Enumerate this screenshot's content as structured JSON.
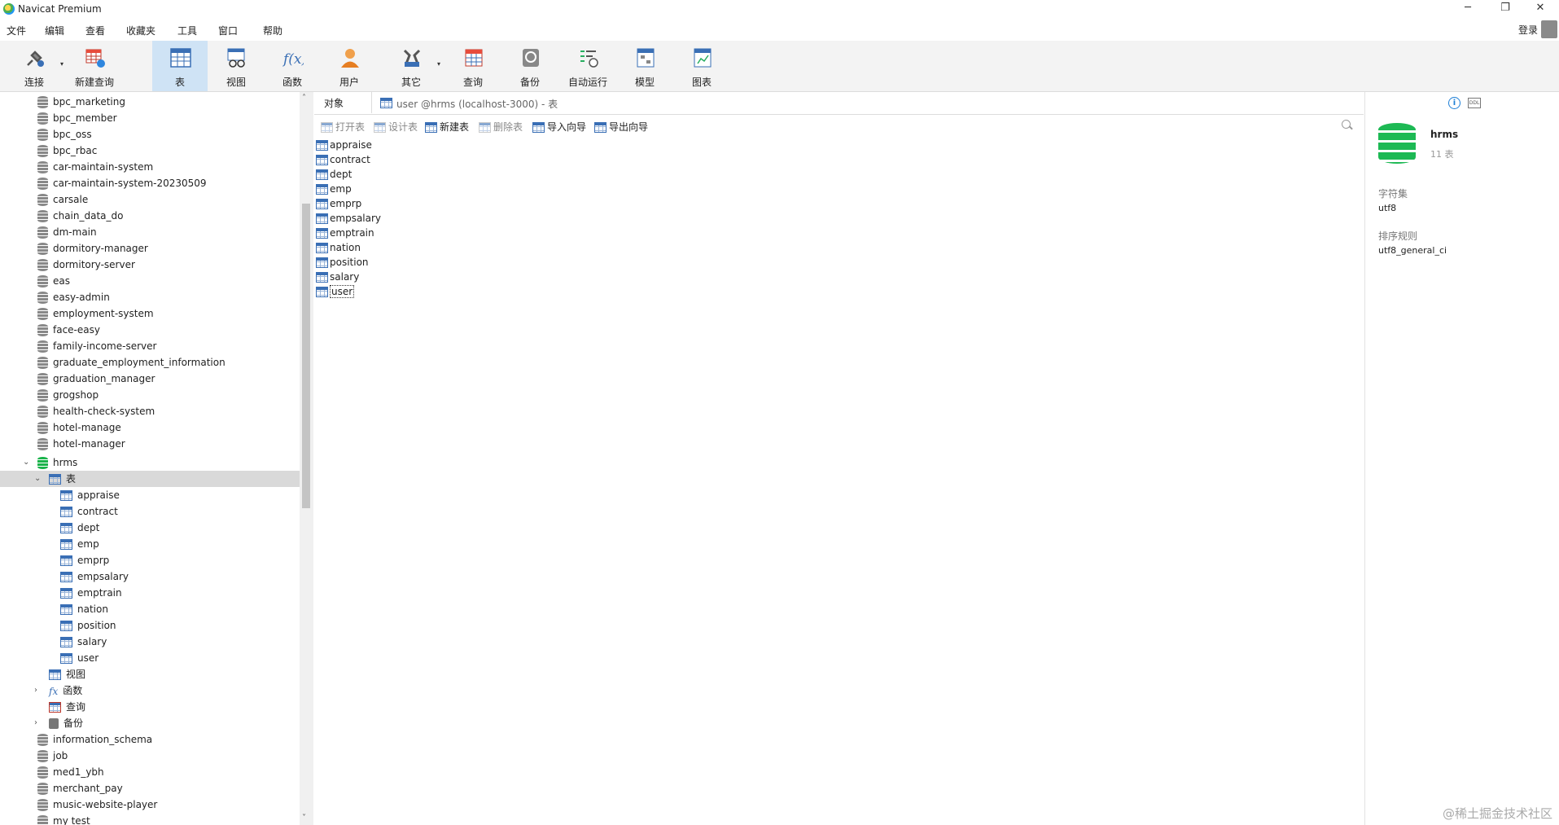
{
  "window": {
    "title": "Navicat Premium",
    "minimize": "─",
    "restore": "❐",
    "close": "✕"
  },
  "menu": [
    "文件",
    "编辑",
    "查看",
    "收藏夹",
    "工具",
    "窗口",
    "帮助"
  ],
  "login": "登录",
  "toolbar": [
    {
      "label": "连接",
      "icon": "plug-icon"
    },
    {
      "label": "新建查询",
      "icon": "new-query-icon"
    },
    {
      "label": "表",
      "icon": "table-icon"
    },
    {
      "label": "视图",
      "icon": "view-icon"
    },
    {
      "label": "函数",
      "icon": "function-icon"
    },
    {
      "label": "用户",
      "icon": "user-icon"
    },
    {
      "label": "其它",
      "icon": "tools-icon"
    },
    {
      "label": "查询",
      "icon": "query-icon"
    },
    {
      "label": "备份",
      "icon": "backup-icon"
    },
    {
      "label": "自动运行",
      "icon": "schedule-icon"
    },
    {
      "label": "模型",
      "icon": "model-icon"
    },
    {
      "label": "图表",
      "icon": "chart-icon"
    }
  ],
  "tree": {
    "databases_top": [
      "bpc_marketing",
      "bpc_member",
      "bpc_oss",
      "bpc_rbac",
      "car-maintain-system",
      "car-maintain-system-20230509",
      "carsale",
      "chain_data_do",
      "dm-main",
      "dormitory-manager",
      "dormitory-server",
      "eas",
      "easy-admin",
      "employment-system",
      "face-easy",
      "family-income-server",
      "graduate_employment_information",
      "graduation_manager",
      "grogshop",
      "health-check-system",
      "hotel-manage",
      "hotel-manager"
    ],
    "open_db": "hrms",
    "tables_node": "表",
    "tables": [
      "appraise",
      "contract",
      "dept",
      "emp",
      "emprp",
      "empsalary",
      "emptrain",
      "nation",
      "position",
      "salary",
      "user"
    ],
    "views_node": "视图",
    "functions_node": "函数",
    "queries_node": "查询",
    "backups_node": "备份",
    "databases_bottom": [
      "information_schema",
      "job",
      "med1_ybh",
      "merchant_pay",
      "music-website-player",
      "my test"
    ]
  },
  "main": {
    "objects_tab": "对象",
    "active_tab": "user @hrms (localhost-3000) - 表",
    "actions": [
      {
        "label": "打开表",
        "enabled": false
      },
      {
        "label": "设计表",
        "enabled": false
      },
      {
        "label": "新建表",
        "enabled": true
      },
      {
        "label": "删除表",
        "enabled": false
      },
      {
        "label": "导入向导",
        "enabled": true
      },
      {
        "label": "导出向导",
        "enabled": true
      }
    ],
    "objects": [
      "appraise",
      "contract",
      "dept",
      "emp",
      "emprp",
      "empsalary",
      "emptrain",
      "nation",
      "position",
      "salary",
      "user"
    ],
    "selected_object": "user"
  },
  "info_panel": {
    "db_name": "hrms",
    "table_count": "11 表",
    "charset_label": "字符集",
    "charset": "utf8",
    "collation_label": "排序规则",
    "collation": "utf8_general_ci"
  },
  "watermark": "@稀土掘金技术社区"
}
